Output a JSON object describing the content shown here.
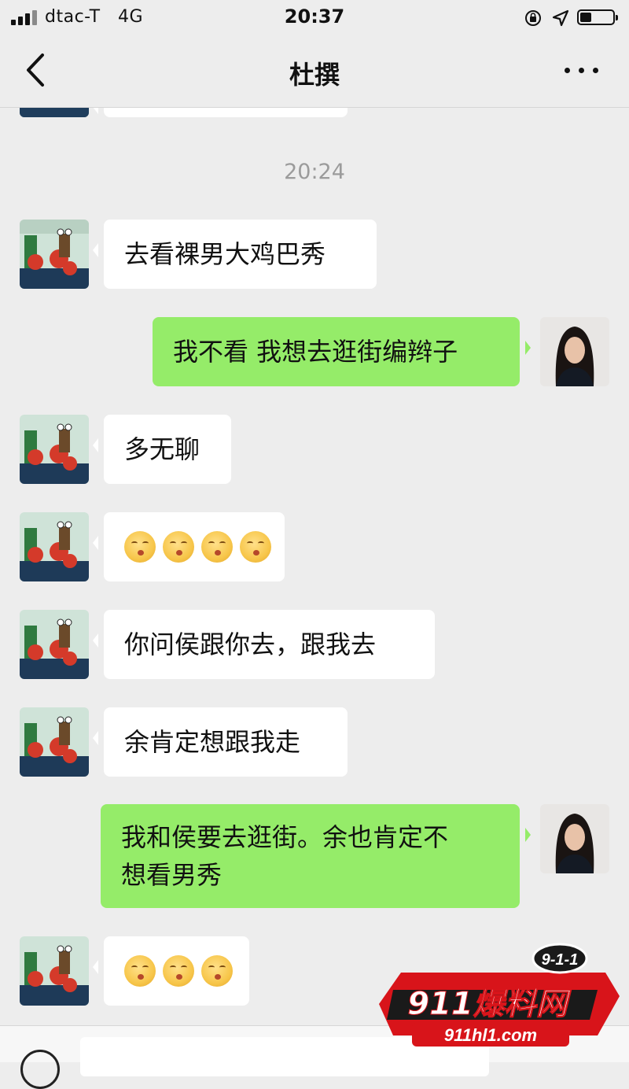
{
  "status_bar": {
    "carrier": "dtac-T",
    "network": "4G",
    "time": "20:37",
    "battery_level": 0.35,
    "icons": [
      "signal-icon",
      "rotation-lock-icon",
      "location-icon",
      "battery-icon"
    ]
  },
  "nav": {
    "title": "杜撰",
    "back_icon": "chevron-left-icon",
    "more_icon": "more-dots-icon"
  },
  "chat": {
    "timestamp": "20:24",
    "messages": [
      {
        "side": "in",
        "text": "去看裸男大鸡巴秀"
      },
      {
        "side": "out",
        "text": "我不看 我想去逛街编辫子"
      },
      {
        "side": "in",
        "text": "多无聊"
      },
      {
        "side": "in",
        "emoji_count": 4,
        "emoji": "kissing-face-emoji"
      },
      {
        "side": "in",
        "text": "你问侯跟你去，跟我去"
      },
      {
        "side": "in",
        "text": "余肯定想跟我走"
      },
      {
        "side": "out",
        "lines": [
          "我和侯要去逛街。余也肯定不",
          "想看男秀"
        ]
      },
      {
        "side": "in",
        "emoji_count": 3,
        "emoji": "kissing-face-emoji"
      }
    ]
  },
  "watermark": {
    "badge": "9-1-1",
    "brand": "911爆料网",
    "url": "911hl1.com"
  },
  "colors": {
    "background": "#ededed",
    "incoming_bubble": "#ffffff",
    "outgoing_bubble": "#95ec69",
    "watermark_red": "#d8141a"
  }
}
